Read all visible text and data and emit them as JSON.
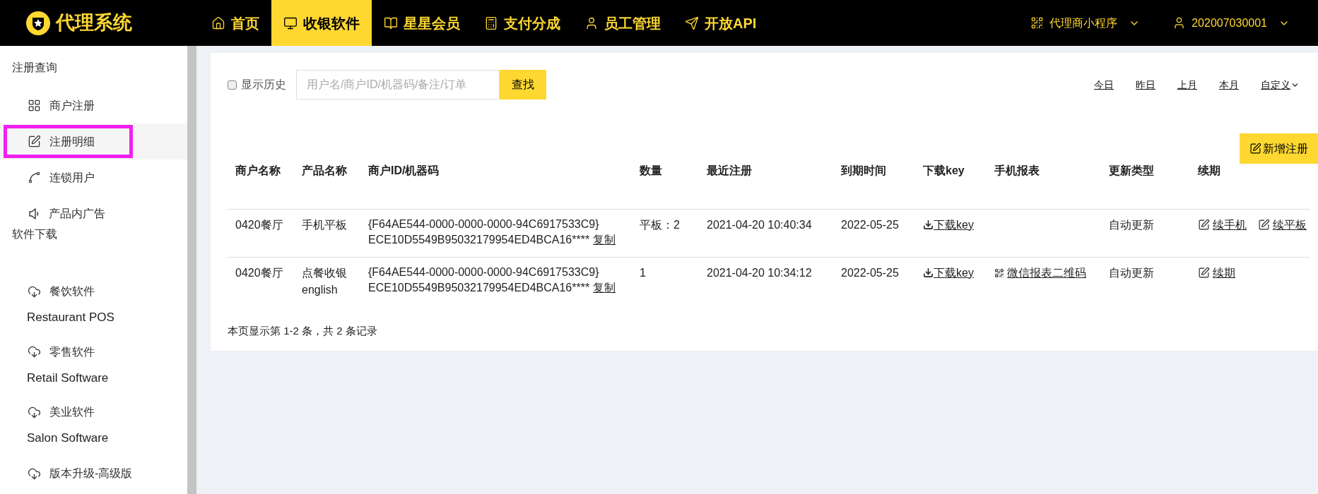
{
  "brand": {
    "title": "代理系统"
  },
  "nav": [
    {
      "label": "首页",
      "selected": false
    },
    {
      "label": "收银软件",
      "selected": true
    },
    {
      "label": "星星会员",
      "selected": false
    },
    {
      "label": "支付分成",
      "selected": false
    },
    {
      "label": "员工管理",
      "selected": false
    },
    {
      "label": "开放API",
      "selected": false
    }
  ],
  "nav_right": [
    {
      "label": "代理商小程序"
    },
    {
      "label": "202007030001"
    }
  ],
  "sidebar": {
    "sections": [
      {
        "title": "注册查询",
        "items": [
          {
            "label": "商户注册",
            "selected": false
          },
          {
            "label": "注册明细",
            "selected": true
          },
          {
            "label": "连锁用户",
            "selected": false
          },
          {
            "label": "产品内广告",
            "selected": false
          }
        ]
      },
      {
        "title": "软件下载",
        "items": [
          {
            "label": "餐饮软件",
            "subtitle": "Restaurant POS",
            "selected": false
          },
          {
            "label": "零售软件",
            "subtitle": "Retail Software",
            "selected": false
          },
          {
            "label": "美业软件",
            "subtitle": "Salon Software",
            "selected": false
          },
          {
            "label": "版本升级-高级版",
            "selected": false
          }
        ]
      }
    ]
  },
  "filters": {
    "show_history": {
      "label": "显示历史",
      "checked": false
    },
    "search": {
      "placeholder": "用户名/商户ID/机器码/备注/订单",
      "button": "查找"
    },
    "date_links": [
      {
        "label": "今日",
        "kind": "link"
      },
      {
        "label": "昨日",
        "kind": "link"
      },
      {
        "label": "上月",
        "kind": "link"
      },
      {
        "label": "本月",
        "kind": "link"
      },
      {
        "label": "自定义",
        "kind": "dropdown"
      }
    ]
  },
  "new_button": "新增注册",
  "table": {
    "columns": [
      "商户名称",
      "产品名称",
      "商户ID/机器码",
      "数量",
      "最近注册",
      "到期时间",
      "下载key",
      "手机报表",
      "更新类型",
      "续期"
    ],
    "rows": [
      {
        "merchant": "0420餐厅",
        "product": "手机平板",
        "id_line": "{F64AE544-0000-0000-0000-94C6917533C9}",
        "machine": "ECE10D5549B95032179954ED4BCA16****",
        "copy": "复制",
        "quantity": "平板：2",
        "last_registered": "2021-04-20 10:40:34",
        "expires": "2022-05-25",
        "download": "下载key",
        "update_type": "自动更新",
        "renew": [
          "续手机",
          "续平板"
        ]
      },
      {
        "merchant": "0420餐厅",
        "product": "点餐收银 english",
        "id_line": "{F64AE544-0000-0000-0000-94C6917533C9}",
        "machine": "ECE10D5549B95032179954ED4BCA16****",
        "copy": "复制",
        "quantity": "1",
        "last_registered": "2021-04-20 10:34:12",
        "expires": "2022-05-25",
        "download": "下载key",
        "report": "微信报表二维码",
        "update_type": "自动更新",
        "renew": [
          "续期"
        ]
      }
    ]
  },
  "footer": "本页显示第 1-2 条，共 2 条记录"
}
